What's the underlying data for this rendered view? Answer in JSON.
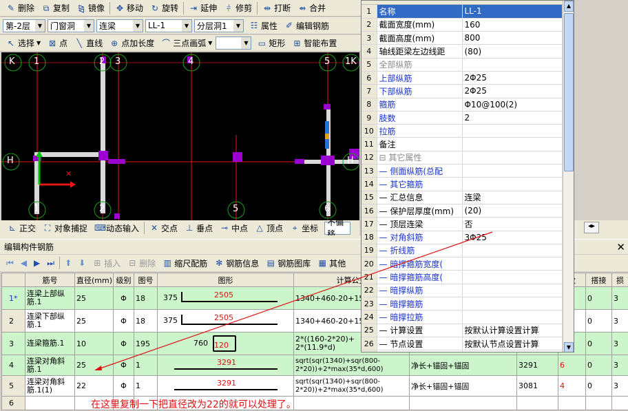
{
  "toolbar1": {
    "delete": "删除",
    "copy": "复制",
    "mirror": "镜像",
    "move": "移动",
    "rotate": "旋转",
    "extend": "延伸",
    "trim": "修剪",
    "break": "打断",
    "merge": "合并"
  },
  "toolbar2": {
    "floor": "第-2层",
    "category": "门窗洞",
    "type": "连梁",
    "element": "LL-1",
    "layer": "分层洞1",
    "props": "属性",
    "edit_rebar": "编辑钢筋"
  },
  "toolbar3": {
    "select": "选择",
    "point": "点",
    "line": "直线",
    "point_len": "点加长度",
    "arc": "三点画弧",
    "rect": "矩形",
    "smart": "智能布置"
  },
  "axes": {
    "top": [
      "K",
      "1",
      "2",
      "3",
      "4",
      "5",
      "1K"
    ],
    "left": "H",
    "right": "H",
    "bottom": [
      "1",
      "2",
      "5",
      "6"
    ]
  },
  "snapbar": {
    "ortho": "正交",
    "osnap": "对象捕捉",
    "dyn": "动态输入",
    "inter": "交点",
    "perp": "垂点",
    "mid": "中点",
    "vert": "顶点",
    "coord": "坐标",
    "nooffset": "不偏移"
  },
  "editor": {
    "title": "编辑构件钢筋",
    "close": "✕",
    "insert": "插入",
    "delete": "删除",
    "scale": "缩尺配筋",
    "info": "钢筋信息",
    "lib": "钢筋图库",
    "other": "其他"
  },
  "grid": {
    "headers": [
      "筋号",
      "直径(mm)",
      "级别",
      "图号",
      "图形",
      "计算公式",
      "",
      "",
      "",
      "数",
      "搭接",
      "损"
    ],
    "rows": [
      {
        "idx": "1*",
        "name": "连梁上部纵筋.1",
        "dia": "25",
        "grade": "Φ",
        "fig": "18",
        "left": "375",
        "len": "2505",
        "formula": "1340+460-20+15",
        "d1": "",
        "d2": "",
        "d3": "",
        "cnt": "",
        "lap": "0",
        "loss": "3"
      },
      {
        "idx": "2",
        "name": "连梁下部纵筋.1",
        "dia": "25",
        "grade": "Φ",
        "fig": "18",
        "left": "375",
        "len": "2505",
        "formula": "1340+460-20+15",
        "d1": "",
        "d2": "",
        "d3": "",
        "cnt": "",
        "lap": "0",
        "loss": "3"
      },
      {
        "idx": "3",
        "name": "连梁箍筋.1",
        "dia": "10",
        "grade": "Φ",
        "fig": "195",
        "left": "760",
        "len": "120",
        "formula": "2*((160-2*20)+\n2*(11.9*d)",
        "d1": "",
        "d2": "",
        "d3": "",
        "cnt": "",
        "lap": "0",
        "loss": "3"
      },
      {
        "idx": "4",
        "name": "连梁对角斜筋.1",
        "dia": "25",
        "grade": "Φ",
        "fig": "1",
        "left": "",
        "len": "3291",
        "formula": "sqrt(sqr(1340)+sqr(800-2*20))+2*max(35*d,600)",
        "d1": "净长+锚固+锚固",
        "d2": "3291",
        "d3": "6",
        "cnt": "",
        "lap": "0",
        "loss": "3"
      },
      {
        "idx": "5",
        "name": "连梁对角斜筋.1(1)",
        "dia": "22",
        "grade": "Φ",
        "fig": "1",
        "left": "",
        "len": "3291",
        "formula": "sqrt(sqr(1340)+sqr(800-2*20))+2*max(35*d,600)",
        "d1": "净长+锚固+锚固",
        "d2": "3081",
        "d3": "4",
        "cnt": "",
        "lap": "0",
        "loss": "3"
      },
      {
        "idx": "6",
        "name": "",
        "dia": "",
        "grade": "",
        "fig": "",
        "left": "",
        "len": "",
        "formula": "",
        "d1": "",
        "d2": "",
        "d3": "",
        "cnt": "",
        "lap": "",
        "loss": ""
      }
    ]
  },
  "props": [
    {
      "n": "1",
      "k": "名称",
      "v": "LL-1",
      "c": "sel"
    },
    {
      "n": "2",
      "k": "截面宽度(mm)",
      "v": "160",
      "c": ""
    },
    {
      "n": "3",
      "k": "截面高度(mm)",
      "v": "800",
      "c": ""
    },
    {
      "n": "4",
      "k": "轴线距梁左边线距",
      "v": "(80)",
      "c": ""
    },
    {
      "n": "5",
      "k": "全部纵筋",
      "v": "",
      "c": "grey"
    },
    {
      "n": "6",
      "k": "上部纵筋",
      "v": "2Φ25",
      "c": "blue"
    },
    {
      "n": "7",
      "k": "下部纵筋",
      "v": "2Φ25",
      "c": "blue"
    },
    {
      "n": "8",
      "k": "箍筋",
      "v": "Φ10@100(2)",
      "c": "blue"
    },
    {
      "n": "9",
      "k": "肢数",
      "v": "2",
      "c": "blue"
    },
    {
      "n": "10",
      "k": "拉筋",
      "v": "",
      "c": "blue"
    },
    {
      "n": "11",
      "k": "备注",
      "v": "",
      "c": ""
    },
    {
      "n": "12",
      "k": "⊟ 其它属性",
      "v": "",
      "c": "grey"
    },
    {
      "n": "13",
      "k": "— 侧面纵筋(总配",
      "v": "",
      "c": "blue"
    },
    {
      "n": "14",
      "k": "— 其它箍筋",
      "v": "",
      "c": "blue"
    },
    {
      "n": "15",
      "k": "— 汇总信息",
      "v": "连梁",
      "c": ""
    },
    {
      "n": "16",
      "k": "— 保护层厚度(mm)",
      "v": "(20)",
      "c": ""
    },
    {
      "n": "17",
      "k": "— 顶层连梁",
      "v": "否",
      "c": ""
    },
    {
      "n": "18",
      "k": "— 对角斜筋",
      "v": "3Φ25",
      "c": "blue"
    },
    {
      "n": "19",
      "k": "— 折线筋",
      "v": "",
      "c": "blue"
    },
    {
      "n": "20",
      "k": "— 暗撑箍筋宽度(",
      "v": "",
      "c": "blue"
    },
    {
      "n": "21",
      "k": "— 暗撑箍筋高度(",
      "v": "",
      "c": "blue"
    },
    {
      "n": "22",
      "k": "— 暗撑纵筋",
      "v": "",
      "c": "blue"
    },
    {
      "n": "23",
      "k": "— 暗撑箍筋",
      "v": "",
      "c": "blue"
    },
    {
      "n": "24",
      "k": "— 暗撑拉筋",
      "v": "",
      "c": "blue"
    },
    {
      "n": "25",
      "k": "— 计算设置",
      "v": "按默认计算设置计算",
      "c": ""
    },
    {
      "n": "26",
      "k": "— 节点设置",
      "v": "按默认节点设置计算",
      "c": ""
    },
    {
      "n": "27",
      "k": "— 搭接设置",
      "v": "按默认搭接设置计算",
      "c": ""
    }
  ],
  "note": "在这里复制一下把直径改为22的就可以处理了。"
}
